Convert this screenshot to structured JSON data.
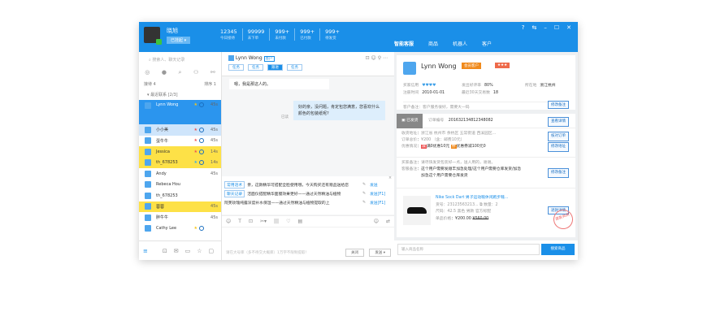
{
  "user": {
    "name": "晓旭",
    "status": "已挂起 ▾"
  },
  "stats": [
    {
      "v": "12345",
      "l": "今日接待"
    },
    {
      "v": "99999",
      "l": "未下单"
    },
    {
      "v": "999+",
      "l": "未付款"
    },
    {
      "v": "999+",
      "l": "已付款"
    },
    {
      "v": "999+",
      "l": "待发货"
    }
  ],
  "window_controls": [
    "?",
    "⇆",
    "–",
    "☐",
    "✕"
  ],
  "right_tabs": [
    "智能客服",
    "商品",
    "机器人",
    "客户"
  ],
  "left": {
    "search_placeholder": "搜索人、聊天记录",
    "icons": [
      "chat-icon",
      "contact-icon",
      "search-icon",
      "group-icon",
      "org-icon"
    ],
    "group_left": "接待 4",
    "group_right": "排序 1",
    "section": "最近联系 [2/3]",
    "items": [
      {
        "name": "Lynn Wong",
        "time": "45s",
        "state": "active"
      },
      {
        "name": "小小美",
        "time": "45s",
        "state": "sel"
      },
      {
        "name": "蛋牛牛",
        "time": "45s",
        "state": ""
      },
      {
        "name": "Jessica",
        "time": "14s",
        "state": "hl"
      },
      {
        "name": "th_678253",
        "time": "14s",
        "state": "hl"
      },
      {
        "name": "Andy",
        "time": "45s",
        "state": ""
      },
      {
        "name": "Rebeca Hou",
        "time": "",
        "state": ""
      },
      {
        "name": "th_678253",
        "time": "",
        "state": ""
      },
      {
        "name": "蓉蓉",
        "time": "45s",
        "state": "hl"
      },
      {
        "name": "胖牛牛",
        "time": "45s",
        "state": ""
      },
      {
        "name": "Cathy Lee",
        "time": "",
        "state": ""
      }
    ]
  },
  "chat": {
    "contact": "Lynn Wong",
    "contact_tag": "客户",
    "tags": [
      "任务",
      "任务",
      "跟进",
      "任务"
    ],
    "msg_in": "嗯，我是那这人的。",
    "msg_out": "好的亲，没问题，肯定包您满意，您喜欢什么颜色的包装纸呢?",
    "read": "已读",
    "quick": [
      {
        "k": "常用话术",
        "t": "亲，这款精华可搭配全脸使用哦，今天购买还有赠品送给您",
        "s": "发送"
      },
      {
        "k": "聊天记录",
        "t": "洁面仪搭配精华面膜效果更好——通过天然精油与植物",
        "s": "发送[F1]"
      },
      {
        "k": "",
        "t": "阿芙玫瑰纯露深度补水保湿——通过天然精油与植物提取的上",
        "s": "发送[F1]"
      }
    ],
    "input_placeholder": "请在大号库（多不待交大概库）1万字不限制提取！",
    "close": "关闭",
    "send": "发送 ▾"
  },
  "customer": {
    "name": "Lynn Wong",
    "badge1": "会员客户",
    "badge2": "★★★",
    "rows": [
      [
        "买家信用",
        "♥♥♥♥"
      ],
      [
        "发出好评率",
        "80%"
      ],
      [
        "所在地",
        "浙江杭州"
      ],
      [
        "注册时间",
        "2010-01-01"
      ],
      [
        "最近30天交易数",
        "18"
      ]
    ],
    "note": "客户备注：客户服务很好，需要大一码",
    "note_btn": "修改备注"
  },
  "order": {
    "status": "已发货",
    "no_label": "订单编号",
    "no": "201632134812348082",
    "detail_btn": "查看详情",
    "addr_label": "收货地址",
    "addr": "浙江省 杭州市 余杭区 五常街道 西溪园区...",
    "price_label": "订单总价",
    "price": "¥200 （含：邮费10元）",
    "promo_label": "优惠情况",
    "promo1": "满0优惠10元",
    "promo2": "优惠券减100元0",
    "btn_check": "核对订单",
    "btn_addr": "修改地址",
    "bmemo_label": "买家备注",
    "bmemo": "请尽快发货包装好一点，送人用的，谢谢。",
    "smemo_label": "客服备注",
    "smemo": "这个用户需要发顺丰加急处理/这个用户需要仓库发货/加急加急这个用户需要仓库发货",
    "btn_memo": "修改备注",
    "product": "Nike Sock Dart 男子运动鞋休闲跑步鞋...",
    "sku_label": "货号",
    "sku": "23123563213...",
    "qty_label": "数量",
    "qty": "2",
    "attr_label": "尺码",
    "attr": "42.5 黑色 男款 官方标配",
    "price2_label": "单品价格",
    "price2": "¥200.00",
    "orig": "¥560.00",
    "refund_btn": "退款详情",
    "stamp": "退款关闭"
  },
  "goods_search": {
    "placeholder": "输入商品名称",
    "button": "搜索商品"
  }
}
